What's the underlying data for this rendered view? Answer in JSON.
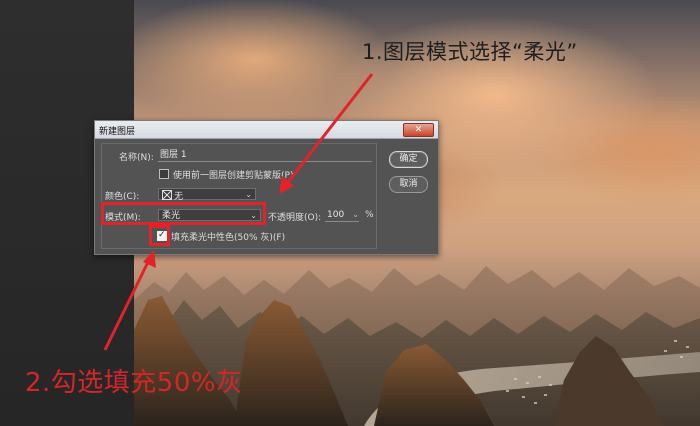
{
  "dialog": {
    "title": "新建图层",
    "close_label": "✕",
    "name_label": "名称(N):",
    "name_value": "图层 1",
    "clip_checkbox_label": "使用前一图层创建剪贴蒙版(P)",
    "clip_checked": false,
    "color_label": "颜色(C):",
    "color_value": "无",
    "mode_label": "模式(M):",
    "mode_value": "柔光",
    "opacity_label": "不透明度(O):",
    "opacity_value": "100",
    "opacity_unit": "%",
    "fill_checkbox_label": "填充柔光中性色(50% 灰)(F)",
    "fill_checked": true,
    "ok_label": "确定",
    "cancel_label": "取消"
  },
  "annotations": {
    "step1": "1.图层模式选择“柔光”",
    "step2": "2.勾选填充50%灰",
    "color": "#e1242a"
  },
  "colors": {
    "dialog_bg": "#535353",
    "titlebar": "#dfe3e8",
    "accent_red": "#e1242a"
  }
}
